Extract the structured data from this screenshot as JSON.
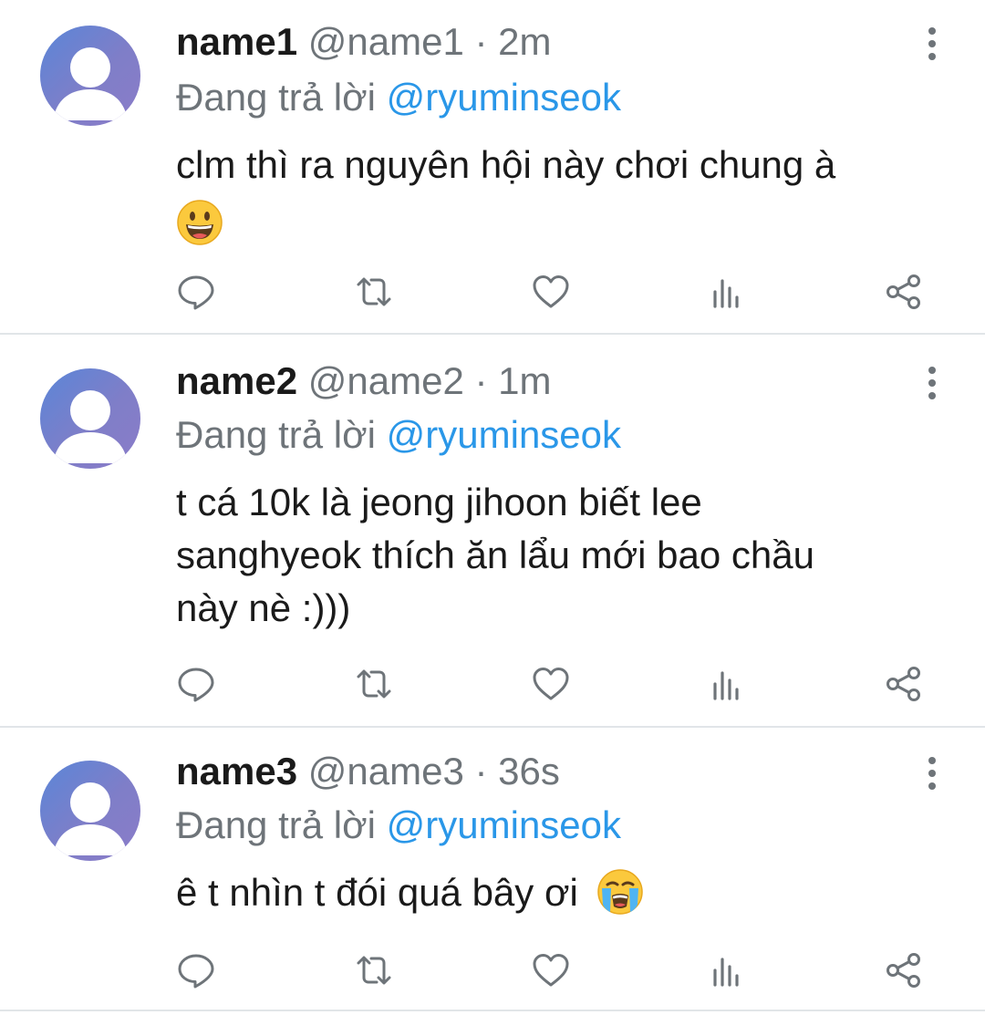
{
  "tweets": [
    {
      "name": "name1",
      "handle": "@name1",
      "separator": "·",
      "time": "2m",
      "reply_prefix": "Đang trả lời",
      "reply_handle": "@ryuminseok",
      "text": "clm thì ra nguyên hội này chơi chung à",
      "emoji": "grinning-face-emoji"
    },
    {
      "name": "name2",
      "handle": "@name2",
      "separator": "·",
      "time": "1m",
      "reply_prefix": "Đang trả lời",
      "reply_handle": "@ryuminseok",
      "text_lines": [
        "t cá 10k là jeong jihoon biết lee",
        "sanghyeok thích ăn lẩu mới bao chầu",
        "này nè :)))"
      ]
    },
    {
      "name": "name3",
      "handle": "@name3",
      "separator": "·",
      "time": "36s",
      "reply_prefix": "Đang trả lời",
      "reply_handle": "@ryuminseok",
      "text": "ê t nhìn t đói quá bây ơi",
      "emoji": "loudly-crying-face-emoji"
    }
  ],
  "icons": {
    "reply": "comment-icon",
    "retweet": "retweet-icon",
    "like": "heart-icon",
    "analytics": "analytics-icon",
    "share": "share-icon",
    "more": "more-vertical-icon",
    "avatar": "default-avatar-icon"
  },
  "colors": {
    "name": "#1a1a1a",
    "secondary": "#6e7479",
    "link": "#2a97e8",
    "avatar_gradient_start": "#5a86d8",
    "avatar_gradient_end": "#8b7cc9",
    "divider": "#e1e5e8"
  }
}
